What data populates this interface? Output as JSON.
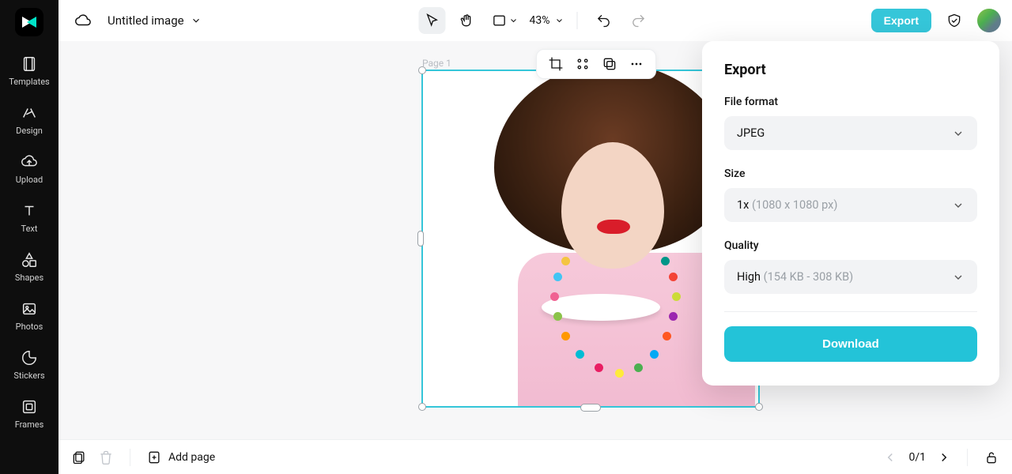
{
  "header": {
    "doc_title": "Untitled image",
    "zoom_label": "43%",
    "export_button": "Export"
  },
  "sidebar": {
    "items": [
      {
        "label": "Templates"
      },
      {
        "label": "Design"
      },
      {
        "label": "Upload"
      },
      {
        "label": "Text"
      },
      {
        "label": "Shapes"
      },
      {
        "label": "Photos"
      },
      {
        "label": "Stickers"
      },
      {
        "label": "Frames"
      }
    ]
  },
  "canvas": {
    "page_label": "Page 1"
  },
  "export_panel": {
    "title": "Export",
    "file_format_label": "File format",
    "file_format_value": "JPEG",
    "size_label": "Size",
    "size_value_prefix": "1x",
    "size_value_dims": "(1080 x 1080 px)",
    "quality_label": "Quality",
    "quality_value_prefix": "High",
    "quality_value_range": "(154 KB - 308 KB)",
    "download_button": "Download"
  },
  "bottombar": {
    "add_page": "Add page",
    "page_indicator_current": "0",
    "page_indicator_sep": "/",
    "page_indicator_total": "1"
  },
  "colors": {
    "accent": "#23c3d8",
    "highlight_border": "#e11"
  }
}
